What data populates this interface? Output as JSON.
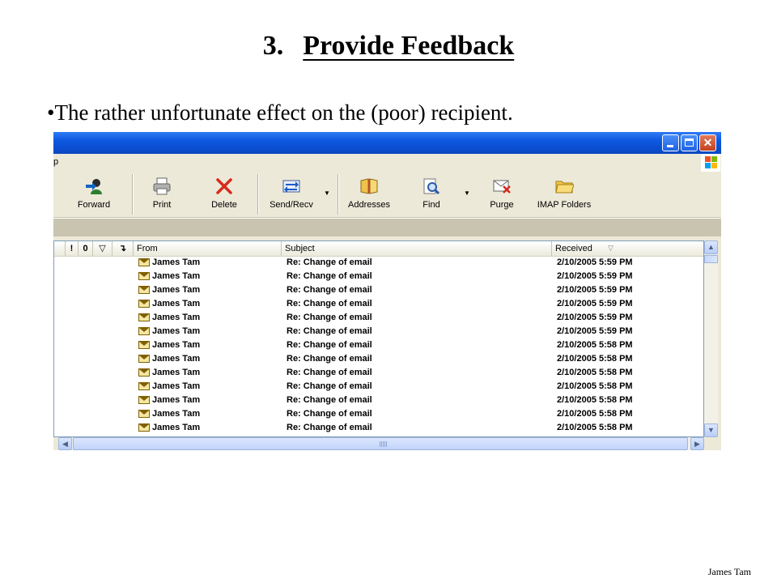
{
  "slide": {
    "title_number": "3.",
    "title_text": "Provide Feedback",
    "bullet": "•The rather unfortunate effect on the (poor) recipient.",
    "footer": "James Tam"
  },
  "window": {
    "menu_fragment": "p"
  },
  "toolbar": {
    "buttons": [
      {
        "label": "Forward",
        "icon": "forward-icon"
      },
      {
        "label": "Print",
        "icon": "printer-icon"
      },
      {
        "label": "Delete",
        "icon": "delete-x-icon"
      },
      {
        "label": "Send/Recv",
        "icon": "send-receive-icon"
      },
      {
        "label": "Addresses",
        "icon": "address-book-icon"
      },
      {
        "label": "Find",
        "icon": "find-icon"
      },
      {
        "label": "Purge",
        "icon": "purge-icon"
      },
      {
        "label": "IMAP Folders",
        "icon": "folder-icon"
      }
    ]
  },
  "list": {
    "columns": {
      "priority": "!",
      "attachment": "0",
      "flag": "▽",
      "arrow": "↴",
      "from": "From",
      "subject": "Subject",
      "received": "Received"
    },
    "rows": [
      {
        "from": "James Tam",
        "subject": "Re: Change of email",
        "received": "2/10/2005 5:59 PM"
      },
      {
        "from": "James Tam",
        "subject": "Re: Change of email",
        "received": "2/10/2005 5:59 PM"
      },
      {
        "from": "James Tam",
        "subject": "Re: Change of email",
        "received": "2/10/2005 5:59 PM"
      },
      {
        "from": "James Tam",
        "subject": "Re: Change of email",
        "received": "2/10/2005 5:59 PM"
      },
      {
        "from": "James Tam",
        "subject": "Re: Change of email",
        "received": "2/10/2005 5:59 PM"
      },
      {
        "from": "James Tam",
        "subject": "Re: Change of email",
        "received": "2/10/2005 5:59 PM"
      },
      {
        "from": "James Tam",
        "subject": "Re: Change of email",
        "received": "2/10/2005 5:58 PM"
      },
      {
        "from": "James Tam",
        "subject": "Re: Change of email",
        "received": "2/10/2005 5:58 PM"
      },
      {
        "from": "James Tam",
        "subject": "Re: Change of email",
        "received": "2/10/2005 5:58 PM"
      },
      {
        "from": "James Tam",
        "subject": "Re: Change of email",
        "received": "2/10/2005 5:58 PM"
      },
      {
        "from": "James Tam",
        "subject": "Re: Change of email",
        "received": "2/10/2005 5:58 PM"
      },
      {
        "from": "James Tam",
        "subject": "Re: Change of email",
        "received": "2/10/2005 5:58 PM"
      },
      {
        "from": "James Tam",
        "subject": "Re: Change of email",
        "received": "2/10/2005 5:58 PM"
      }
    ]
  },
  "colors": {
    "titlebar": "#0b4fd2",
    "chrome": "#ece9d8",
    "close_button": "#c3421f"
  }
}
